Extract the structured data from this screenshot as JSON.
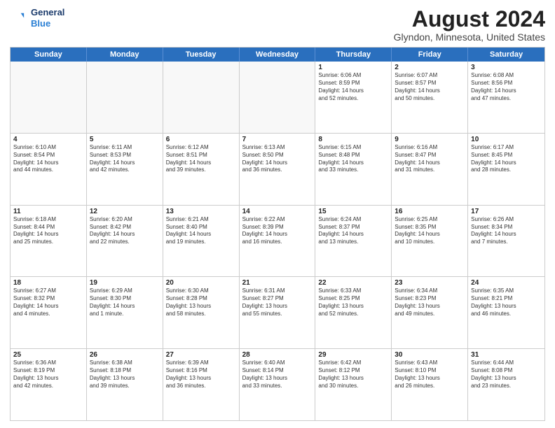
{
  "header": {
    "logo_line1": "General",
    "logo_line2": "Blue",
    "title": "August 2024",
    "subtitle": "Glyndon, Minnesota, United States"
  },
  "days_of_week": [
    "Sunday",
    "Monday",
    "Tuesday",
    "Wednesday",
    "Thursday",
    "Friday",
    "Saturday"
  ],
  "weeks": [
    [
      {
        "day": "",
        "text": ""
      },
      {
        "day": "",
        "text": ""
      },
      {
        "day": "",
        "text": ""
      },
      {
        "day": "",
        "text": ""
      },
      {
        "day": "1",
        "text": "Sunrise: 6:06 AM\nSunset: 8:59 PM\nDaylight: 14 hours\nand 52 minutes."
      },
      {
        "day": "2",
        "text": "Sunrise: 6:07 AM\nSunset: 8:57 PM\nDaylight: 14 hours\nand 50 minutes."
      },
      {
        "day": "3",
        "text": "Sunrise: 6:08 AM\nSunset: 8:56 PM\nDaylight: 14 hours\nand 47 minutes."
      }
    ],
    [
      {
        "day": "4",
        "text": "Sunrise: 6:10 AM\nSunset: 8:54 PM\nDaylight: 14 hours\nand 44 minutes."
      },
      {
        "day": "5",
        "text": "Sunrise: 6:11 AM\nSunset: 8:53 PM\nDaylight: 14 hours\nand 42 minutes."
      },
      {
        "day": "6",
        "text": "Sunrise: 6:12 AM\nSunset: 8:51 PM\nDaylight: 14 hours\nand 39 minutes."
      },
      {
        "day": "7",
        "text": "Sunrise: 6:13 AM\nSunset: 8:50 PM\nDaylight: 14 hours\nand 36 minutes."
      },
      {
        "day": "8",
        "text": "Sunrise: 6:15 AM\nSunset: 8:48 PM\nDaylight: 14 hours\nand 33 minutes."
      },
      {
        "day": "9",
        "text": "Sunrise: 6:16 AM\nSunset: 8:47 PM\nDaylight: 14 hours\nand 31 minutes."
      },
      {
        "day": "10",
        "text": "Sunrise: 6:17 AM\nSunset: 8:45 PM\nDaylight: 14 hours\nand 28 minutes."
      }
    ],
    [
      {
        "day": "11",
        "text": "Sunrise: 6:18 AM\nSunset: 8:44 PM\nDaylight: 14 hours\nand 25 minutes."
      },
      {
        "day": "12",
        "text": "Sunrise: 6:20 AM\nSunset: 8:42 PM\nDaylight: 14 hours\nand 22 minutes."
      },
      {
        "day": "13",
        "text": "Sunrise: 6:21 AM\nSunset: 8:40 PM\nDaylight: 14 hours\nand 19 minutes."
      },
      {
        "day": "14",
        "text": "Sunrise: 6:22 AM\nSunset: 8:39 PM\nDaylight: 14 hours\nand 16 minutes."
      },
      {
        "day": "15",
        "text": "Sunrise: 6:24 AM\nSunset: 8:37 PM\nDaylight: 14 hours\nand 13 minutes."
      },
      {
        "day": "16",
        "text": "Sunrise: 6:25 AM\nSunset: 8:35 PM\nDaylight: 14 hours\nand 10 minutes."
      },
      {
        "day": "17",
        "text": "Sunrise: 6:26 AM\nSunset: 8:34 PM\nDaylight: 14 hours\nand 7 minutes."
      }
    ],
    [
      {
        "day": "18",
        "text": "Sunrise: 6:27 AM\nSunset: 8:32 PM\nDaylight: 14 hours\nand 4 minutes."
      },
      {
        "day": "19",
        "text": "Sunrise: 6:29 AM\nSunset: 8:30 PM\nDaylight: 14 hours\nand 1 minute."
      },
      {
        "day": "20",
        "text": "Sunrise: 6:30 AM\nSunset: 8:28 PM\nDaylight: 13 hours\nand 58 minutes."
      },
      {
        "day": "21",
        "text": "Sunrise: 6:31 AM\nSunset: 8:27 PM\nDaylight: 13 hours\nand 55 minutes."
      },
      {
        "day": "22",
        "text": "Sunrise: 6:33 AM\nSunset: 8:25 PM\nDaylight: 13 hours\nand 52 minutes."
      },
      {
        "day": "23",
        "text": "Sunrise: 6:34 AM\nSunset: 8:23 PM\nDaylight: 13 hours\nand 49 minutes."
      },
      {
        "day": "24",
        "text": "Sunrise: 6:35 AM\nSunset: 8:21 PM\nDaylight: 13 hours\nand 46 minutes."
      }
    ],
    [
      {
        "day": "25",
        "text": "Sunrise: 6:36 AM\nSunset: 8:19 PM\nDaylight: 13 hours\nand 42 minutes."
      },
      {
        "day": "26",
        "text": "Sunrise: 6:38 AM\nSunset: 8:18 PM\nDaylight: 13 hours\nand 39 minutes."
      },
      {
        "day": "27",
        "text": "Sunrise: 6:39 AM\nSunset: 8:16 PM\nDaylight: 13 hours\nand 36 minutes."
      },
      {
        "day": "28",
        "text": "Sunrise: 6:40 AM\nSunset: 8:14 PM\nDaylight: 13 hours\nand 33 minutes."
      },
      {
        "day": "29",
        "text": "Sunrise: 6:42 AM\nSunset: 8:12 PM\nDaylight: 13 hours\nand 30 minutes."
      },
      {
        "day": "30",
        "text": "Sunrise: 6:43 AM\nSunset: 8:10 PM\nDaylight: 13 hours\nand 26 minutes."
      },
      {
        "day": "31",
        "text": "Sunrise: 6:44 AM\nSunset: 8:08 PM\nDaylight: 13 hours\nand 23 minutes."
      }
    ]
  ]
}
